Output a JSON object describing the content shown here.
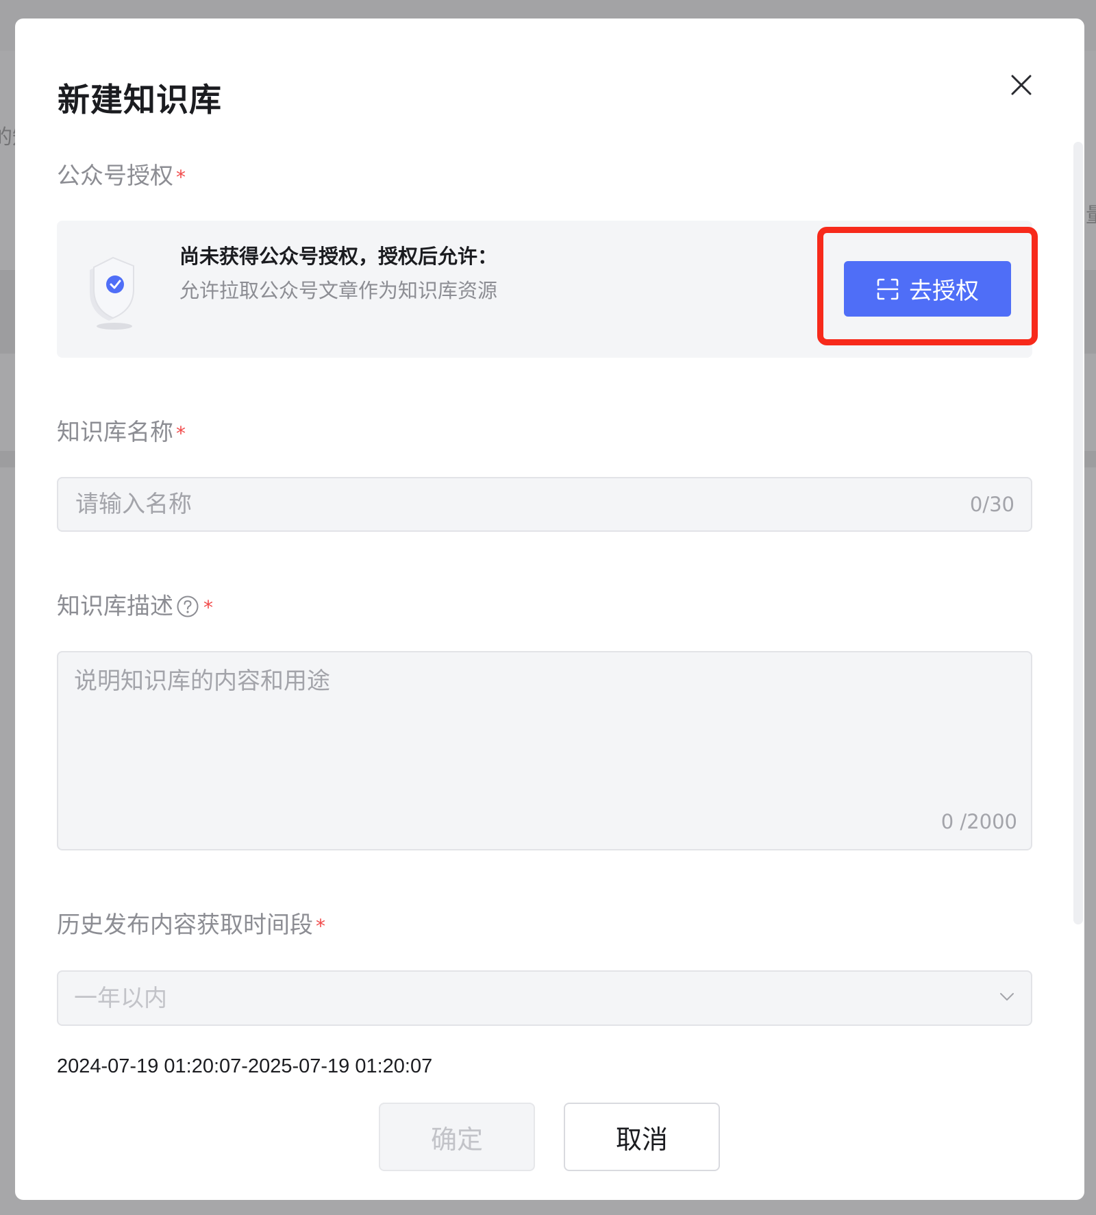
{
  "modal": {
    "title": "新建知识库",
    "close_icon": "close-icon"
  },
  "backdrop": {
    "peek_left": "的知",
    "peek_right": "量"
  },
  "account_auth": {
    "label": "公众号授权",
    "required_mark": "*",
    "notice_title": "尚未获得公众号授权，授权后允许：",
    "notice_desc": "允许拉取公众号文章作为知识库资源",
    "button_label": "去授权",
    "button_icon": "scan-icon",
    "illustration": "shield-icon",
    "highlight_color": "#f72a1b",
    "button_color": "#4f6ef7"
  },
  "name_field": {
    "label": "知识库名称",
    "required_mark": "*",
    "placeholder": "请输入名称",
    "counter": "0/30"
  },
  "description_field": {
    "label": "知识库描述",
    "required_mark": "*",
    "help_icon": "question-circle-icon",
    "placeholder": "说明知识库的内容和用途",
    "counter": "0 /2000"
  },
  "history_field": {
    "label": "历史发布内容获取时间段",
    "required_mark": "*",
    "selected": "一年以内",
    "dropdown_icon": "chevron-down-icon",
    "range_text": "2024-07-19 01:20:07-2025-07-19 01:20:07"
  },
  "footer": {
    "confirm_label": "确定",
    "cancel_label": "取消"
  }
}
